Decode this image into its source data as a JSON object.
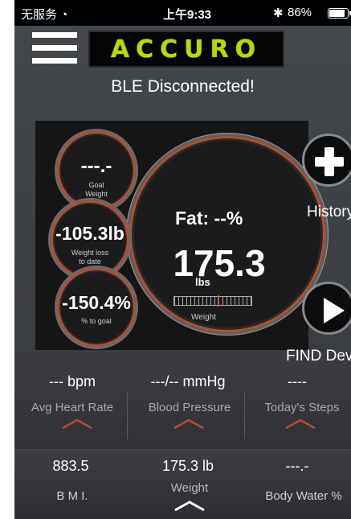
{
  "status_bar": {
    "carrier": "无服务",
    "time": "上午9:33",
    "battery": "86%",
    "battery_level": 0.86
  },
  "header": {
    "logo_text": "ACCURO",
    "ble_status": "BLE Disconnected!"
  },
  "dials": {
    "goal_value": "---.-",
    "goal_label": "Goal\nWeight",
    "loss_value": "-105.3lb",
    "loss_label": "Weight loss\nto date",
    "pct_value": "-150.4%",
    "pct_label": "% to goal"
  },
  "main_dial": {
    "fat": "Fat: --%",
    "weight": "175.3",
    "unit": "lbs",
    "caption": "Weight"
  },
  "actions": {
    "history": "History",
    "find": "FIND Devi"
  },
  "metrics_top": [
    {
      "value": "--- bpm",
      "label": "Avg Heart Rate"
    },
    {
      "value": "---/-- mmHg",
      "label": "Blood Pressure"
    },
    {
      "value": "----",
      "label": "Today's Steps"
    }
  ],
  "metrics_bottom": [
    {
      "value": "883.5",
      "label": "B M I."
    },
    {
      "value": "175.3 lb",
      "label": "Weight"
    },
    {
      "value": "---.-",
      "label": "Body Water %"
    }
  ],
  "colors": {
    "accent": "#b5502c",
    "logo": "#b6d80c"
  }
}
